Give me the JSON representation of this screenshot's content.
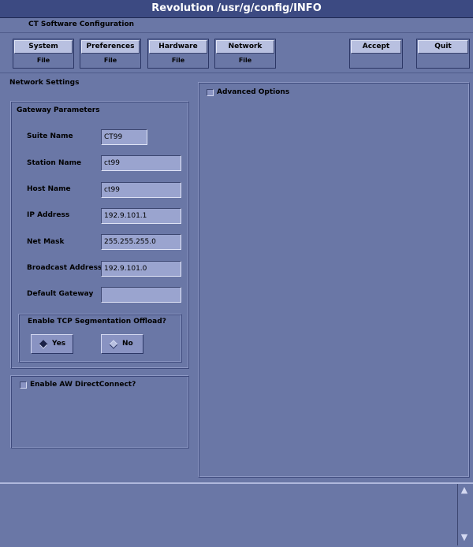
{
  "window": {
    "title": "Revolution /usr/g/config/INFO"
  },
  "header": {
    "subtitle": "CT Software Configuration"
  },
  "toolbar": {
    "groups": [
      {
        "label": "System",
        "sub": "File"
      },
      {
        "label": "Preferences",
        "sub": "File"
      },
      {
        "label": "Hardware",
        "sub": "File"
      },
      {
        "label": "Network",
        "sub": "File"
      }
    ],
    "accept_label": "Accept",
    "quit_label": "Quit"
  },
  "network": {
    "section_label": "Network Settings",
    "gateway_title": "Gateway Parameters",
    "fields": [
      {
        "label": "Suite Name",
        "value": "CT99"
      },
      {
        "label": "Station Name",
        "value": "ct99"
      },
      {
        "label": "Host Name",
        "value": "ct99"
      },
      {
        "label": "IP Address",
        "value": "192.9.101.1"
      },
      {
        "label": "Net Mask",
        "value": "255.255.255.0"
      },
      {
        "label": "Broadcast Address",
        "value": "192.9.101.0"
      },
      {
        "label": "Default Gateway",
        "value": ""
      }
    ],
    "tcp_offload": {
      "question": "Enable TCP Segmentation Offload?",
      "yes_label": "Yes",
      "no_label": "No",
      "selected": "Yes"
    },
    "aw_direct_connect_label": "Enable AW DirectConnect?",
    "advanced_options_label": "Advanced Options"
  },
  "colors": {
    "background": "#6a77a6",
    "titlebar": "#3c4a82",
    "button_face": "#b8c0e0",
    "field_bg": "#9aa4cf"
  }
}
